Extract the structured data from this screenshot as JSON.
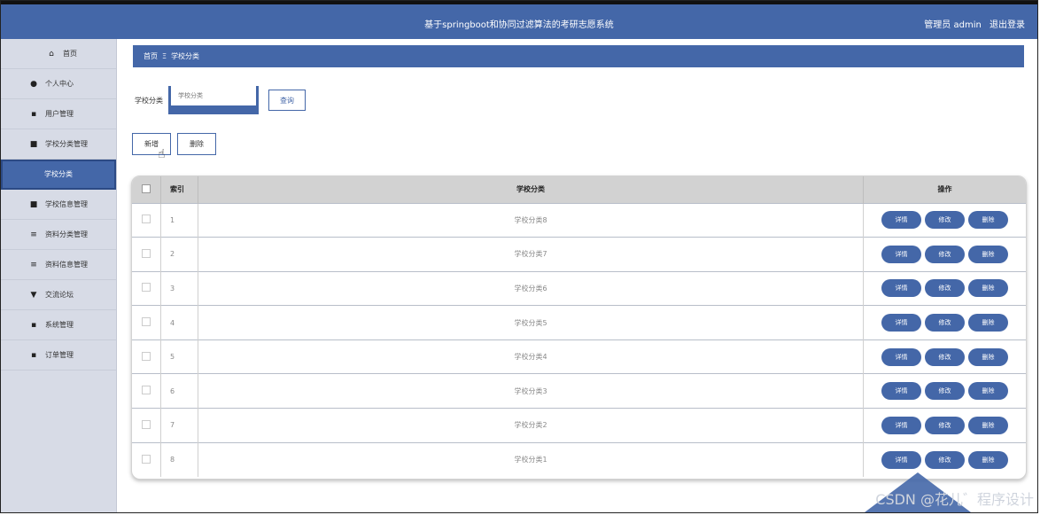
{
  "header": {
    "title": "基于springboot和协同过滤算法的考研志愿系统",
    "user_role": "管理员 admin",
    "logout": "退出登录"
  },
  "sidebar": {
    "items": [
      {
        "label": "首页",
        "icon": "home-icon",
        "glyph": "⌂"
      },
      {
        "label": "个人中心",
        "icon": "user-icon",
        "glyph": "●"
      },
      {
        "label": "用户管理",
        "icon": "grid-icon",
        "glyph": "▪"
      },
      {
        "label": "学校分类管理",
        "icon": "camera-icon",
        "glyph": "■"
      },
      {
        "label": "学校分类",
        "active": true
      },
      {
        "label": "学校信息管理",
        "icon": "book-icon",
        "glyph": "■"
      },
      {
        "label": "资料分类管理",
        "icon": "list-icon",
        "glyph": "≡"
      },
      {
        "label": "资料信息管理",
        "icon": "list-icon",
        "glyph": "≡"
      },
      {
        "label": "交流论坛",
        "icon": "forum-icon",
        "glyph": "▼"
      },
      {
        "label": "系统管理",
        "icon": "grid-icon",
        "glyph": "▪"
      },
      {
        "label": "订单管理",
        "icon": "grid-icon",
        "glyph": "▪"
      }
    ]
  },
  "breadcrumb": {
    "home": "首页",
    "separator": "Ξ",
    "current": "学校分类"
  },
  "search": {
    "label": "学校分类",
    "placeholder": "学校分类",
    "button": "查询"
  },
  "actions": {
    "add": "新增",
    "delete": "删除"
  },
  "table": {
    "headers": {
      "index": "索引",
      "name": "学校分类",
      "ops": "操作"
    },
    "rows": [
      {
        "index": "1",
        "name": "学校分类8"
      },
      {
        "index": "2",
        "name": "学校分类7"
      },
      {
        "index": "3",
        "name": "学校分类6"
      },
      {
        "index": "4",
        "name": "学校分类5"
      },
      {
        "index": "5",
        "name": "学校分类4"
      },
      {
        "index": "6",
        "name": "学校分类3"
      },
      {
        "index": "7",
        "name": "学校分类2"
      },
      {
        "index": "8",
        "name": "学校分类1"
      }
    ],
    "op_labels": {
      "detail": "详情",
      "edit": "修改",
      "delete": "删除"
    }
  },
  "watermark": "CSDN @花儿゛程序设计",
  "colors": {
    "primary": "#4467a8",
    "sidebar_bg": "#d7dbe6",
    "table_header": "#d2d2d2"
  }
}
